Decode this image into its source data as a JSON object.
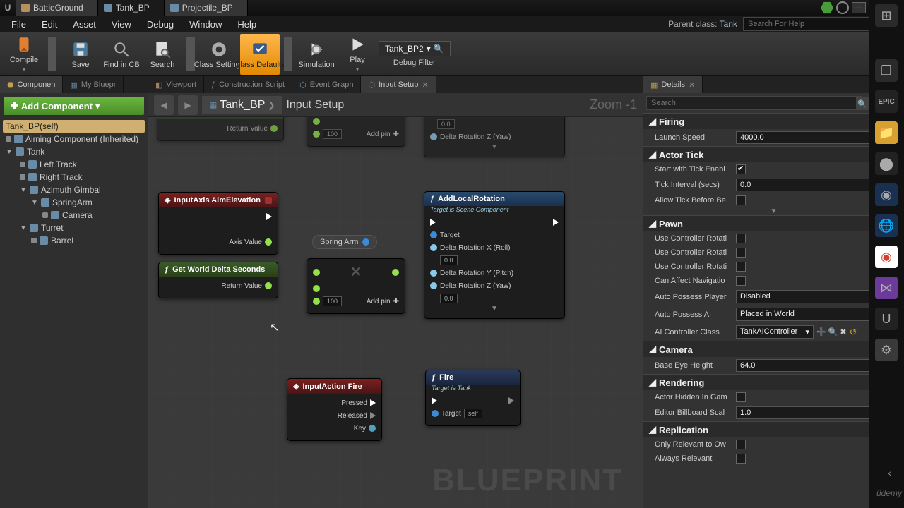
{
  "title_tabs": [
    {
      "label": "BattleGround",
      "icon": "level-icon"
    },
    {
      "label": "Tank_BP",
      "icon": "blueprint-icon"
    },
    {
      "label": "Projectile_BP",
      "icon": "blueprint-icon"
    }
  ],
  "menu": [
    "File",
    "Edit",
    "Asset",
    "View",
    "Debug",
    "Window",
    "Help"
  ],
  "parent_class_label": "Parent class:",
  "parent_class_value": "Tank",
  "help_search_placeholder": "Search For Help",
  "toolbar": {
    "compile": "Compile",
    "save": "Save",
    "find": "Find in CB",
    "search": "Search",
    "settings": "Class Settings",
    "defaults": "Class Defaults",
    "simulation": "Simulation",
    "play": "Play",
    "filter_label": "Debug Filter",
    "filter_value": "Tank_BP2"
  },
  "components": {
    "tab_label": "Componen",
    "blueprint_tab": "My Bluepr",
    "add_btn": "Add Component",
    "root": "Tank_BP(self)",
    "tree": [
      {
        "label": "Aiming Component (Inherited)",
        "indent": 0,
        "bullet": true
      },
      {
        "label": "Tank",
        "indent": 0,
        "arrow": true
      },
      {
        "label": "Left Track",
        "indent": 1,
        "bullet": true
      },
      {
        "label": "Right Track",
        "indent": 1,
        "bullet": true
      },
      {
        "label": "Azimuth Gimbal",
        "indent": 1,
        "arrow": true
      },
      {
        "label": "SpringArm",
        "indent": 2,
        "arrow": true
      },
      {
        "label": "Camera",
        "indent": 3,
        "bullet": true
      },
      {
        "label": "Turret",
        "indent": 1,
        "arrow": true
      },
      {
        "label": "Barrel",
        "indent": 2,
        "bullet": true
      }
    ]
  },
  "graph_tabs": [
    {
      "label": "Viewport",
      "active": false
    },
    {
      "label": "Construction Script",
      "active": false
    },
    {
      "label": "Event Graph",
      "active": false
    },
    {
      "label": "Input Setup",
      "active": true
    }
  ],
  "breadcrumb": {
    "bp": "Tank_BP",
    "fn": "Input Setup"
  },
  "zoom": "Zoom -1",
  "nodes": {
    "get_delta_top": "Get World Delta Seconds",
    "return_value": "Return Value",
    "add_pin": "Add pin",
    "mult_100": "100",
    "input_aim": "InputAxis AimElevation",
    "axis_value": "Axis Value",
    "spring_arm": "Spring Arm",
    "add_local_rot": "AddLocalRotation",
    "target_scene": "Target is Scene Component",
    "target": "Target",
    "roll": "Delta Rotation X (Roll)",
    "pitch": "Delta Rotation Y (Pitch)",
    "yaw": "Delta Rotation Z (Yaw)",
    "zero": "0.0",
    "get_delta2": "Get World Delta Seconds",
    "input_fire": "InputAction Fire",
    "pressed": "Pressed",
    "released": "Released",
    "key": "Key",
    "fire": "Fire",
    "target_tank": "Target is Tank",
    "self": "self"
  },
  "details": {
    "tab": "Details",
    "search_placeholder": "Search",
    "categories": {
      "firing": "Firing",
      "actor_tick": "Actor Tick",
      "pawn": "Pawn",
      "camera": "Camera",
      "rendering": "Rendering",
      "replication": "Replication"
    },
    "rows": {
      "launch_speed": {
        "label": "Launch Speed",
        "value": "4000.0"
      },
      "start_tick": {
        "label": "Start with Tick Enabl",
        "checked": true
      },
      "tick_interval": {
        "label": "Tick Interval (secs)",
        "value": "0.0"
      },
      "allow_tick": {
        "label": "Allow Tick Before Be",
        "checked": false
      },
      "uc_rot1": {
        "label": "Use Controller Rotati",
        "checked": false
      },
      "uc_rot2": {
        "label": "Use Controller Rotati",
        "checked": false
      },
      "uc_rot3": {
        "label": "Use Controller Rotati",
        "checked": false
      },
      "can_affect": {
        "label": "Can Affect Navigatio",
        "checked": false
      },
      "auto_possess_player": {
        "label": "Auto Possess Player",
        "value": "Disabled"
      },
      "auto_possess_ai": {
        "label": "Auto Possess AI",
        "value": "Placed in World"
      },
      "ai_controller": {
        "label": "AI Controller Class",
        "value": "TankAIController"
      },
      "base_eye": {
        "label": "Base Eye Height",
        "value": "64.0"
      },
      "actor_hidden": {
        "label": "Actor Hidden In Gam",
        "checked": false
      },
      "billboard_scale": {
        "label": "Editor Billboard Scal",
        "value": "1.0"
      },
      "only_relevant": {
        "label": "Only Relevant to Ow",
        "checked": false
      },
      "always_relevant": {
        "label": "Always Relevant",
        "checked": false
      }
    }
  }
}
